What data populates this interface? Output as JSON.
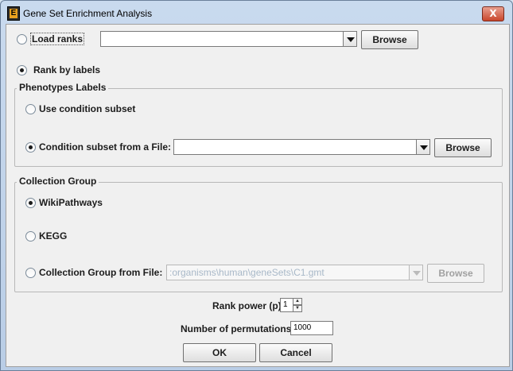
{
  "window": {
    "title": "Gene Set Enrichment Analysis",
    "close_glyph": "X",
    "icon_letter": "E"
  },
  "load_ranks": {
    "label": "Load ranks",
    "selected": false,
    "combo_value": "",
    "browse_label": "Browse"
  },
  "rank_by_labels": {
    "label": "Rank by labels",
    "selected": true
  },
  "phenotypes": {
    "title": "Phenotypes Labels",
    "use_subset": {
      "label": "Use condition subset",
      "selected": false
    },
    "from_file": {
      "label": "Condition subset from a File:",
      "selected": true,
      "combo_value": "",
      "browse_label": "Browse"
    }
  },
  "collection": {
    "title": "Collection Group",
    "wikipathways": {
      "label": "WikiPathways",
      "selected": true
    },
    "kegg": {
      "label": "KEGG",
      "selected": false
    },
    "from_file": {
      "label": "Collection Group from File:",
      "selected": false,
      "combo_value": ":organisms\\human\\geneSets\\C1.gmt",
      "browse_label": "Browse",
      "enabled": false
    }
  },
  "rank_power": {
    "label": "Rank power (p)",
    "value": "1"
  },
  "permutations": {
    "label": "Number of permutations:",
    "value": "1000"
  },
  "buttons": {
    "ok": "OK",
    "cancel": "Cancel"
  }
}
